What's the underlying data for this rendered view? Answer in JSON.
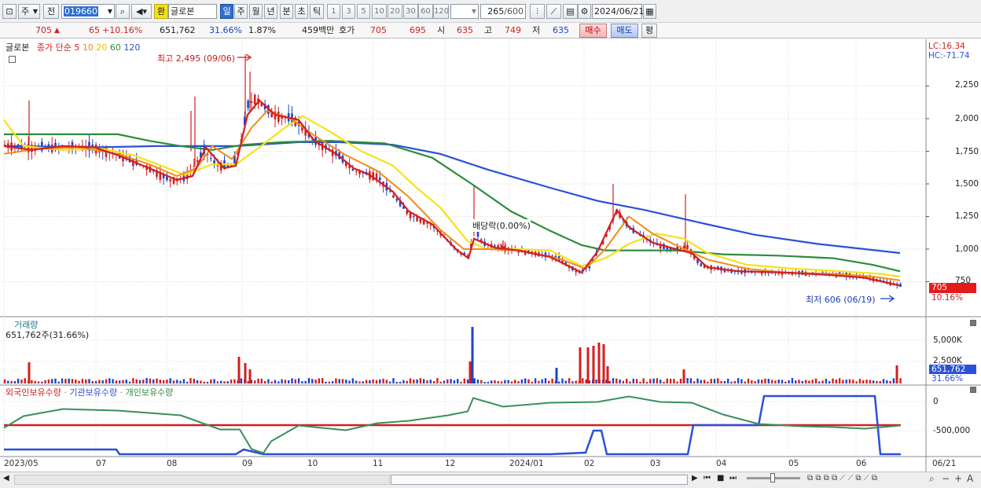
{
  "toolbar": {
    "period": "주",
    "prev_label": "전",
    "code": "019660",
    "exchange_badge": "환",
    "name": "글로본",
    "period_buttons": [
      "일",
      "주",
      "월",
      "년",
      "분",
      "초",
      "틱"
    ],
    "interval_buttons": [
      "1",
      "3",
      "5",
      "10",
      "20",
      "30",
      "60",
      "120"
    ],
    "count": "265",
    "count_total": "/600",
    "date": "2024/06/21"
  },
  "quote": {
    "price": "705",
    "change_arrow": "▲",
    "change": "65",
    "change_pct": "+10.16%",
    "volume": "651,762",
    "turnover_pct": "31.66%",
    "ratio": "1.87%",
    "amount": "459백만",
    "ask_label": "호가",
    "ask": "705",
    "bid": "695",
    "open_label": "시",
    "open": "635",
    "high_label": "고",
    "high": "749",
    "low_label": "저",
    "low": "635",
    "buy_button": "매수",
    "sell_button": "매도",
    "eval_button": "평"
  },
  "price_panel": {
    "stock_name": "글로본",
    "ma_label": "종가 단순",
    "ma_periods": [
      "5",
      "10",
      "20",
      "60",
      "120"
    ],
    "ma_colors": [
      "#d21f1f",
      "#f08c1a",
      "#f4e21c",
      "#2d8c3c",
      "#2c50d8"
    ],
    "high_note": "최고 2,495 (09/06)",
    "low_note": "최저 606 (06/19)",
    "dividend_note": "배당락(0.00%)",
    "lc": "LC:16.34",
    "hc": "HC:-71.74",
    "y_ticks": [
      "2,250",
      "2,000",
      "1,750",
      "1,500",
      "1,250",
      "1,000",
      "750"
    ],
    "last_price": "705",
    "last_change": "10.16%"
  },
  "volume_panel": {
    "title": "거래량",
    "value": "651,762주(31.66%)",
    "y_ticks": [
      "5,000K",
      "2,500K"
    ],
    "last_value": "651,762",
    "last_pct": "31.66%"
  },
  "holding_panel": {
    "legend": [
      "외국인보유수량",
      "기관보유수량",
      "개인보유수량"
    ],
    "legend_colors": [
      "#d21f1f",
      "#2c50d8",
      "#2d8c3c"
    ],
    "y_ticks": [
      "0",
      "-500,000"
    ]
  },
  "x_axis": [
    "2023/05",
    "07",
    "08",
    "09",
    "10",
    "11",
    "12",
    "2024/01",
    "02",
    "03",
    "04",
    "05",
    "06",
    "06/21"
  ]
}
